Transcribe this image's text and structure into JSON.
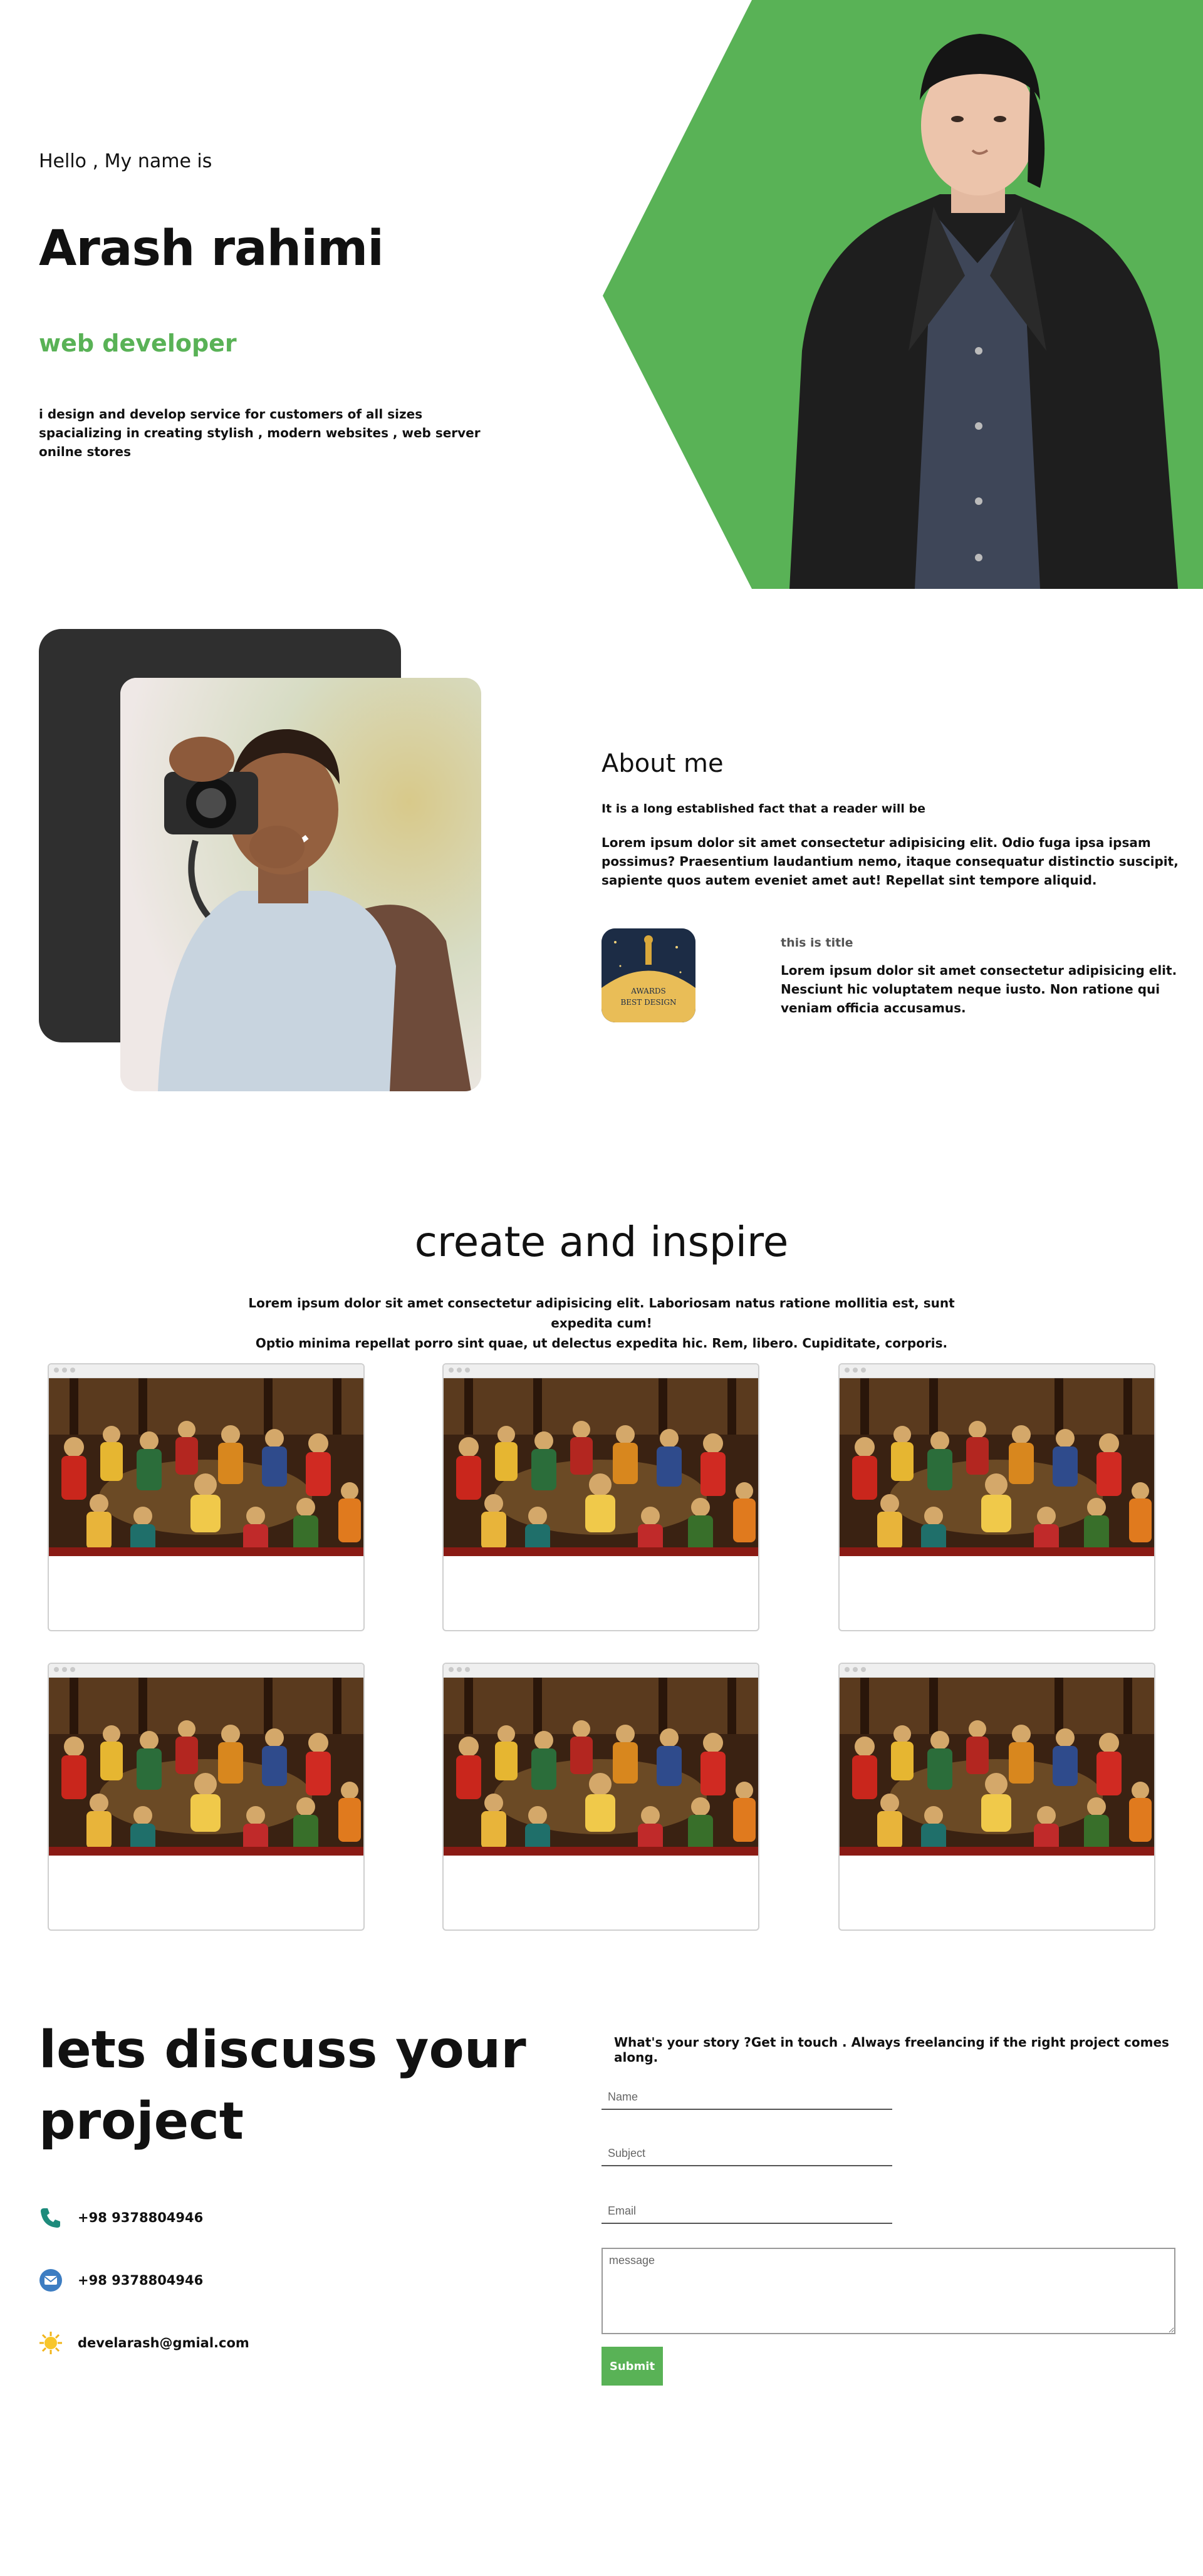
{
  "hero": {
    "greeting": "Hello , My name is",
    "name": "Arash rahimi",
    "role": "web developer",
    "description": "i design and develop service for customers of all sizes spacializing in creating stylish , modern websites , web server onilne stores",
    "accent_color": "#59b256"
  },
  "about": {
    "title": "About me",
    "lead": "It is a long established fact that a reader will be",
    "body": "Lorem ipsum dolor sit amet consectetur adipisicing elit. Odio fuga ipsa ipsam possimus? Praesentium laudantium nemo, itaque consequatur distinctio suscipit, sapiente quos autem eveniet amet aut! Repellat sint tempore aliquid.",
    "feature": {
      "title": "this is title",
      "body": "Lorem ipsum dolor sit amet consectetur adipisicing elit. Nesciunt hic voluptatem neque iusto. Non ratione qui veniam officia accusamus."
    },
    "badge": {
      "line1": "AWARDS",
      "line2": "BEST DESIGN"
    }
  },
  "work": {
    "title": "create and inspire",
    "description_line1": "Lorem ipsum dolor sit amet consectetur adipisicing elit. Laboriosam natus ratione mollitia est, sunt expedita cum!",
    "description_line2": "Optio minima repellat porro sint quae, ut delectus expedita hic. Rem, libero. Cupiditate, corporis.",
    "projects": [
      {
        "thumbnail": "persian-miniature-painting"
      },
      {
        "thumbnail": "persian-miniature-painting"
      },
      {
        "thumbnail": "persian-miniature-painting"
      },
      {
        "thumbnail": "persian-miniature-painting"
      },
      {
        "thumbnail": "persian-miniature-painting"
      },
      {
        "thumbnail": "persian-miniature-painting"
      }
    ]
  },
  "contact": {
    "title": "lets discuss your project",
    "phone": "+98 9378804946",
    "mail_label": "+98 9378804946",
    "email": "develarash@gmial.com",
    "intro_bold": "What's your story ?",
    "intro_rest": "Get in touch . Always freelancing if the right project comes along.",
    "form": {
      "name_placeholder": "Name",
      "subject_placeholder": "Subject",
      "email_placeholder": "Email",
      "message_placeholder": "message",
      "submit_label": "Submit"
    },
    "icons": [
      "phone-icon",
      "mail-icon",
      "sun-icon"
    ]
  }
}
